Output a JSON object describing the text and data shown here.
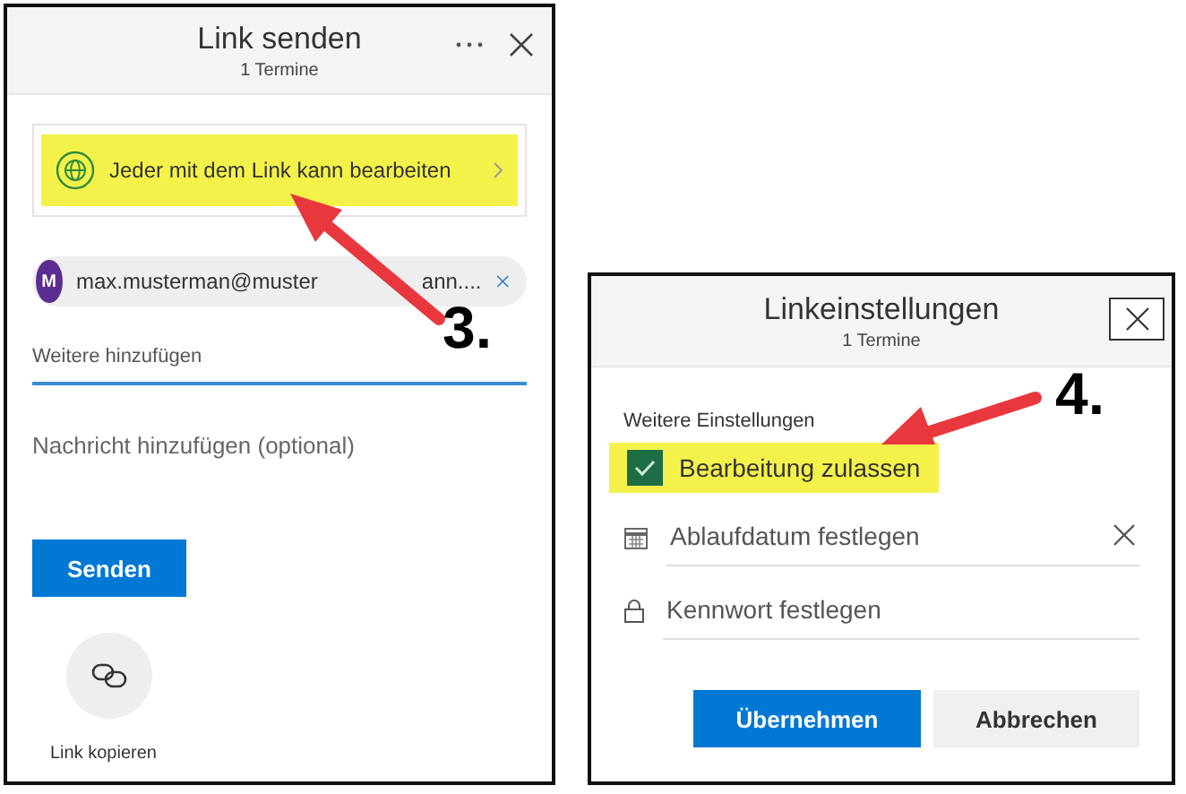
{
  "share_dialog": {
    "title": "Link senden",
    "subtitle": "1 Termine",
    "link_permission": {
      "label": "Jeder mit dem Link kann bearbeiten",
      "highlighted": true
    },
    "recipients": [
      {
        "initial": "M",
        "email_parts": [
          "max.musterman@muster",
          "ann...."
        ]
      }
    ],
    "add_field": {
      "placeholder": "Weitere hinzufügen"
    },
    "message_field": {
      "placeholder": "Nachricht hinzufügen (optional)"
    },
    "send_button": "Senden",
    "copy_link": {
      "label": "Link kopieren"
    }
  },
  "settings_dialog": {
    "title": "Linkeinstellungen",
    "subtitle": "1 Termine",
    "section_label": "Weitere Einstellungen",
    "options": [
      {
        "kind": "checkbox",
        "label": "Bearbeitung zulassen",
        "checked": true,
        "highlighted": true
      },
      {
        "kind": "date",
        "placeholder": "Ablaufdatum festlegen"
      },
      {
        "kind": "password",
        "placeholder": "Kennwort festlegen"
      }
    ],
    "buttons": [
      {
        "label": "Übernehmen",
        "primary": true
      },
      {
        "label": "Abbrechen",
        "primary": false
      }
    ]
  },
  "annotations": [
    {
      "label": "3."
    },
    {
      "label": "4."
    }
  ]
}
